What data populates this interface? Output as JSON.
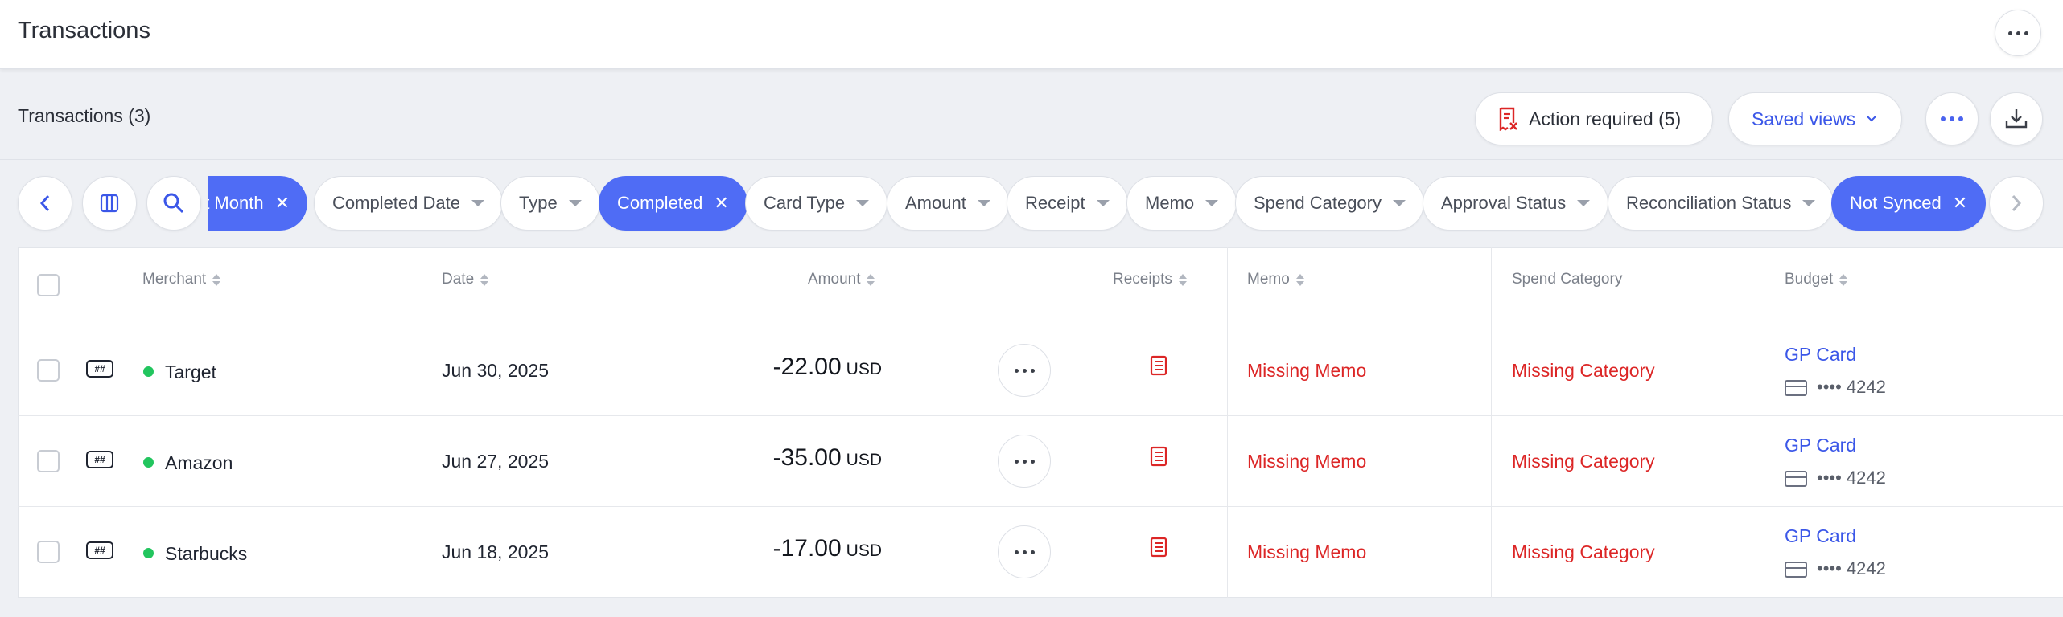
{
  "header": {
    "title": "Transactions"
  },
  "subheader": {
    "title": "Transactions (3)",
    "action_required_label": "Action required (5)",
    "saved_views_label": "Saved views"
  },
  "filters": {
    "partial_chip_label": "t Month",
    "chips": [
      {
        "label": "Completed Date",
        "active": false
      },
      {
        "label": "Type",
        "active": false
      },
      {
        "label": "Completed",
        "active": true
      },
      {
        "label": "Card Type",
        "active": false
      },
      {
        "label": "Amount",
        "active": false
      },
      {
        "label": "Receipt",
        "active": false
      },
      {
        "label": "Memo",
        "active": false
      },
      {
        "label": "Spend Category",
        "active": false
      },
      {
        "label": "Approval Status",
        "active": false
      },
      {
        "label": "Reconciliation Status",
        "active": false
      },
      {
        "label": "Not Synced",
        "active": true
      }
    ]
  },
  "table": {
    "columns": {
      "merchant": "Merchant",
      "date": "Date",
      "amount": "Amount",
      "receipts": "Receipts",
      "memo": "Memo",
      "spend_category": "Spend Category",
      "budget": "Budget"
    },
    "rows": [
      {
        "merchant": "Target",
        "date": "Jun 30, 2025",
        "amount": "-22.00",
        "currency": "USD",
        "memo": "Missing Memo",
        "category": "Missing Category",
        "budget": "GP Card",
        "card_mask": "•••• 4242"
      },
      {
        "merchant": "Amazon",
        "date": "Jun 27, 2025",
        "amount": "-35.00",
        "currency": "USD",
        "memo": "Missing Memo",
        "category": "Missing Category",
        "budget": "GP Card",
        "card_mask": "•••• 4242"
      },
      {
        "merchant": "Starbucks",
        "date": "Jun 18, 2025",
        "amount": "-17.00",
        "currency": "USD",
        "memo": "Missing Memo",
        "category": "Missing Category",
        "budget": "GP Card",
        "card_mask": "•••• 4242"
      }
    ]
  },
  "colors": {
    "accent": "#4f6cf5",
    "link": "#3b57e8",
    "error": "#dc2626",
    "status_ok": "#22c55e"
  }
}
